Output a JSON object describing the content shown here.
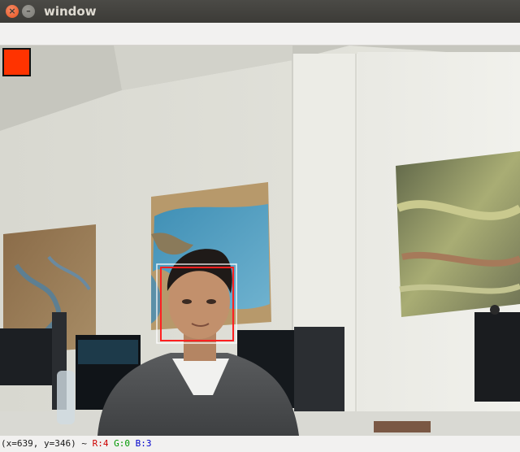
{
  "window": {
    "title": "window",
    "close_glyph": "×",
    "minimize_glyph": "–"
  },
  "status": {
    "coords": "(x=639, y=346) ~ ",
    "r": "R:4",
    "g": "G:0",
    "b": "B:3"
  },
  "colors": {
    "indicator_square": "#ff3300",
    "face_box_outer": "#ffffff",
    "face_box_inner": "#ff2020"
  }
}
